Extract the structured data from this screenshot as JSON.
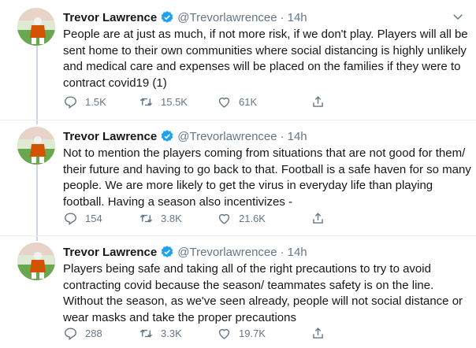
{
  "colors": {
    "secondary": "#657786",
    "verified": "#1da1f2",
    "divider": "#e6ecf0",
    "thread_line": "#ccd6dd"
  },
  "tweets": [
    {
      "name": "Trevor Lawrence",
      "handle": "@Trevorlawrencee",
      "time": "14h",
      "text": "People are at just as much, if not more risk, if we don't play. Players will all be sent home to their own communities where social distancing is highly unlikely and medical care and expenses will be placed on the families if they were to contract covid19 (1)",
      "replies": "1.5K",
      "retweets": "15.5K",
      "likes": "61K"
    },
    {
      "name": "Trevor Lawrence",
      "handle": "@Trevorlawrencee",
      "time": "14h",
      "text": "Not to mention the players coming from situations that are not good for them/ their future and having to go back to that. Football is a safe haven for so many people. We are more likely to get the virus in everyday life than playing football. Having a season also incentivizes -",
      "replies": "154",
      "retweets": "3.8K",
      "likes": "21.6K"
    },
    {
      "name": "Trevor Lawrence",
      "handle": "@Trevorlawrencee",
      "time": "14h",
      "text": "Players being safe and taking all of the right precautions to try to avoid contracting covid because the season/ teammates safety is on the line. Without the season, as we've seen already, people will not social distance or wear masks and take the proper precautions",
      "replies": "288",
      "retweets": "3.3K",
      "likes": "19.7K"
    }
  ],
  "icons": {
    "verified": "verified-badge-icon",
    "more": "chevron-down-icon",
    "reply": "reply-icon",
    "retweet": "retweet-icon",
    "like": "heart-icon",
    "share": "share-icon"
  }
}
